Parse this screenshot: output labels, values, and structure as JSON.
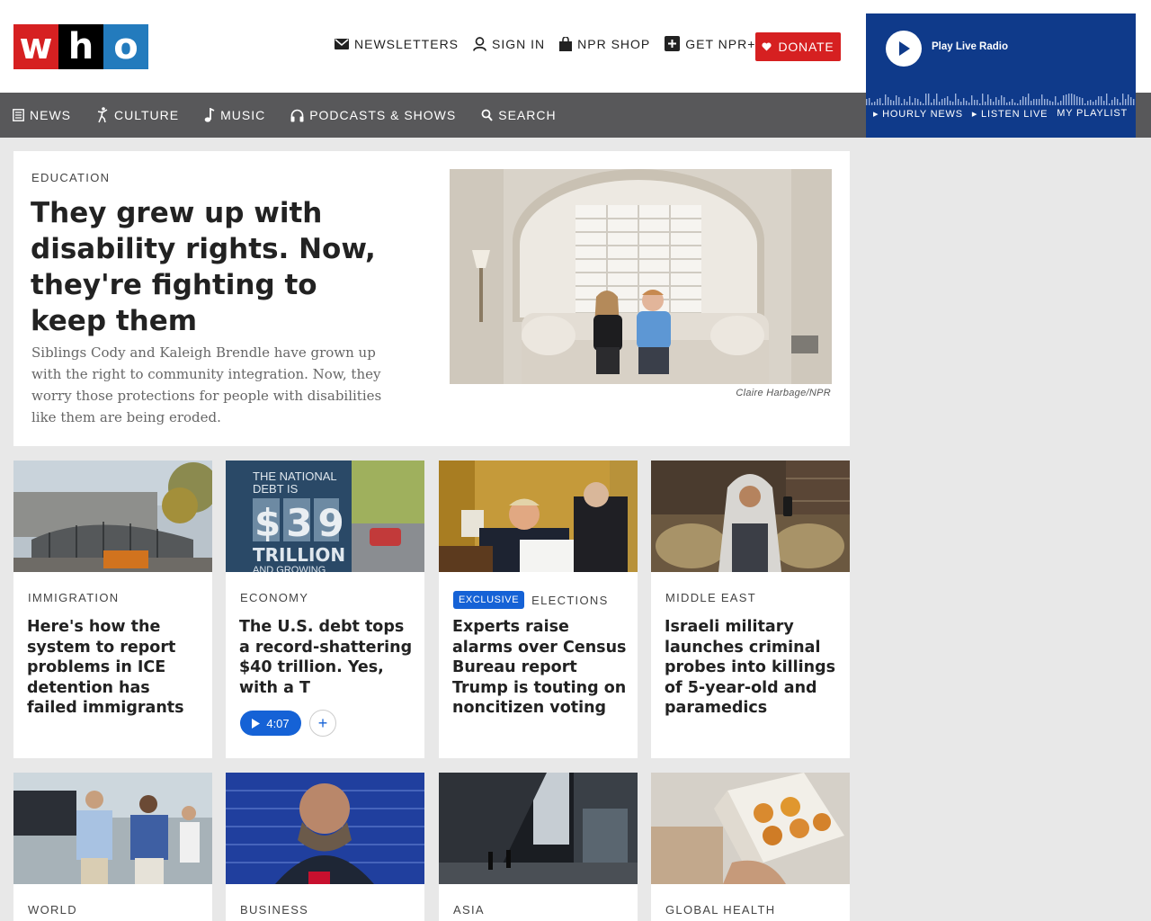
{
  "header": {
    "logo": {
      "letters": [
        "w",
        "h",
        "o"
      ],
      "colors": [
        "#d62021",
        "#000000",
        "#237bbd"
      ]
    },
    "utility": [
      {
        "label": "NEWSLETTERS",
        "icon": "envelope-icon"
      },
      {
        "label": "SIGN IN",
        "icon": "user-icon"
      },
      {
        "label": "NPR SHOP",
        "icon": "shopping-bag-icon"
      },
      {
        "label": "GET NPR+",
        "icon": "plus-square-icon"
      }
    ],
    "donate_label": "DONATE"
  },
  "nav": [
    {
      "label": "NEWS",
      "icon": "news-icon"
    },
    {
      "label": "CULTURE",
      "icon": "dancer-icon"
    },
    {
      "label": "MUSIC",
      "icon": "music-note-icon"
    },
    {
      "label": "PODCASTS & SHOWS",
      "icon": "headphones-icon"
    },
    {
      "label": "SEARCH",
      "icon": "search-icon"
    }
  ],
  "player": {
    "title": "Play Live Radio",
    "links": [
      "▸ HOURLY NEWS",
      "▸ LISTEN LIVE",
      "MY PLAYLIST"
    ]
  },
  "hero": {
    "slug": "EDUCATION",
    "title": "They grew up with disability rights. Now, they're fighting to keep them",
    "teaser": "Siblings Cody and Kaleigh Brendle have grown up with the right to community integration. Now, they worry those protections for people with disabilities like them are being eroded.",
    "credit": "Claire Harbage/NPR"
  },
  "cards": [
    {
      "slug": "IMMIGRATION",
      "title": "Here's how the system to report problems in ICE detention has failed immigrants"
    },
    {
      "slug": "ECONOMY",
      "title": "The U.S. debt tops a record-shattering $40 trillion. Yes, with a T",
      "audio": {
        "duration": "4:07",
        "add": "+"
      },
      "image_text": {
        "line1": "THE NATIONAL",
        "line2": "DEBT IS",
        "amount": "$39",
        "unit": "TRILLION",
        "line3": "AND GROWING"
      }
    },
    {
      "badge": "EXCLUSIVE",
      "slug": "ELECTIONS",
      "title": "Experts raise alarms over Census Bureau report Trump is touting on noncitizen voting"
    },
    {
      "slug": "MIDDLE EAST",
      "title": "Israeli military launches criminal probes into killings of 5-year-old and paramedics"
    },
    {
      "slug": "WORLD"
    },
    {
      "slug": "BUSINESS"
    },
    {
      "slug": "ASIA"
    },
    {
      "slug": "GLOBAL HEALTH"
    }
  ]
}
